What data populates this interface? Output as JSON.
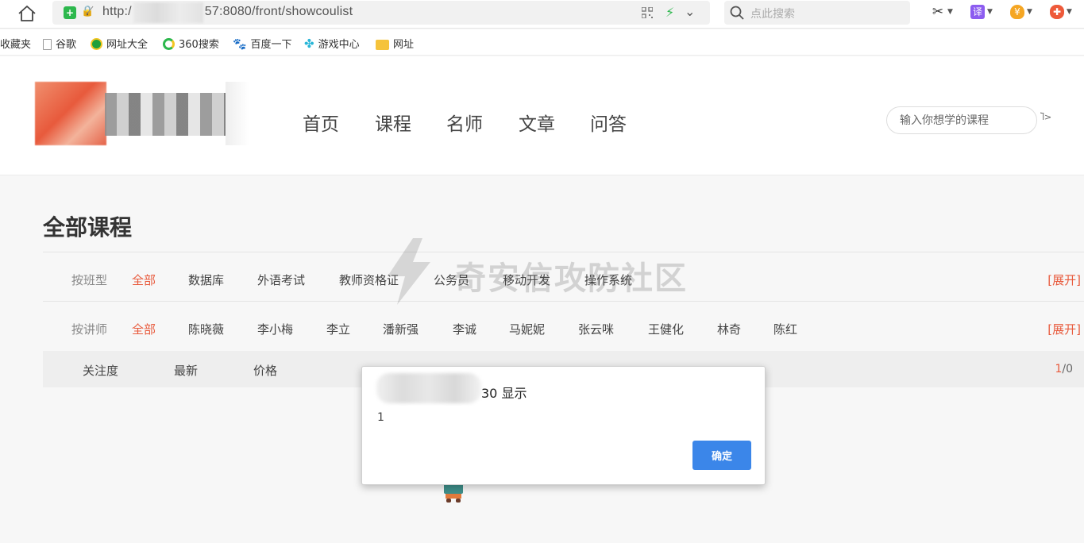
{
  "browser": {
    "url_prefix": "http:/",
    "url_suffix": "57:8080/front/showcoulist",
    "search_placeholder": "点此搜索"
  },
  "bookmarks": [
    {
      "label": "收藏夹",
      "icon": "star-icon"
    },
    {
      "label": "谷歌",
      "icon": "page-icon"
    },
    {
      "label": "网址大全",
      "icon": "globe-icon"
    },
    {
      "label": "360搜索",
      "icon": "search-360-icon"
    },
    {
      "label": "百度一下",
      "icon": "baidu-paw-icon"
    },
    {
      "label": "游戏中心",
      "icon": "gamepad-icon"
    },
    {
      "label": "网址",
      "icon": "folder-icon"
    }
  ],
  "nav": {
    "items": [
      "首页",
      "课程",
      "名师",
      "文章",
      "问答"
    ],
    "search_placeholder": "输入你想学的课程",
    "search_button_alt": "Ⴈ>"
  },
  "main": {
    "title": "全部课程",
    "class_filter": {
      "label": "按班型",
      "options": [
        "全部",
        "数据库",
        "外语考试",
        "教师资格证",
        "公务员",
        "移动开发",
        "操作系统"
      ],
      "expand": "[展开]"
    },
    "teacher_filter": {
      "label": "按讲师",
      "options": [
        "全部",
        "陈晓薇",
        "李小梅",
        "李立",
        "潘新强",
        "李诚",
        "马妮妮",
        "张云咪",
        "王健化",
        "林奇",
        "陈红"
      ],
      "expand": "[展开]"
    },
    "sort": {
      "options": [
        "关注度",
        "最新",
        "价格"
      ],
      "page_current": "1",
      "page_sep": "/",
      "page_total": "0"
    }
  },
  "watermark": {
    "text": "奇安信攻防社区"
  },
  "dialog": {
    "title": "30 显示",
    "message": "1",
    "ok_label": "确定"
  },
  "colors": {
    "accent": "#e85a3c",
    "dialog_button": "#3b86e9",
    "secure_green": "#2db84d"
  }
}
